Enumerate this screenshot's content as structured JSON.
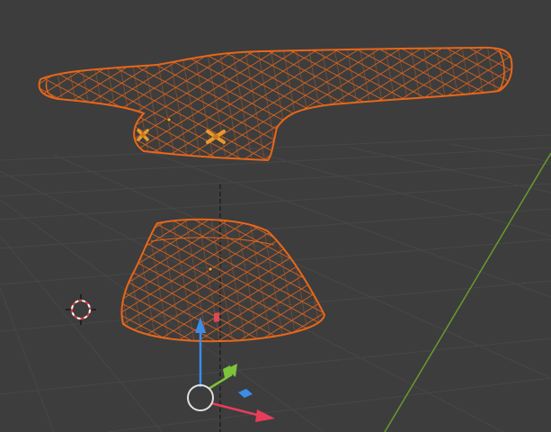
{
  "viewport": {
    "background": "#3d3d3d",
    "grid_color": "#4a4a4a",
    "y_axis_color": "#6a9a2a",
    "selection_color": "#e8661a",
    "origin_color": "#f0a020",
    "light_icon_color": "#e89a2c"
  },
  "objects": [
    {
      "name": "upper-mesh",
      "display": "wireframe",
      "selected": true
    },
    {
      "name": "lower-mesh",
      "display": "wireframe",
      "selected": true
    }
  ],
  "cursor": {
    "icon": "3d-cursor-icon"
  },
  "gizmo": {
    "type": "translate",
    "axes": [
      {
        "axis": "x",
        "color": "#e83c5a"
      },
      {
        "axis": "y",
        "color": "#7cc43a"
      },
      {
        "axis": "z",
        "color": "#3c8ce8"
      }
    ],
    "center_icon": "circle-handle-icon"
  }
}
